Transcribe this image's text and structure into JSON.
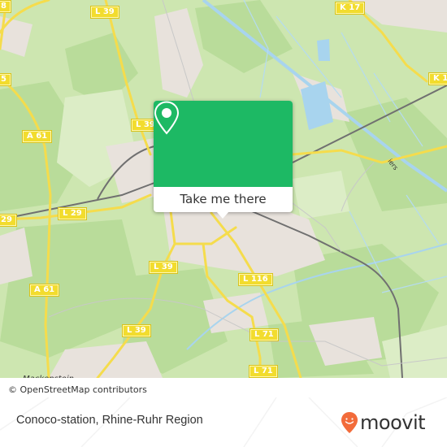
{
  "map": {
    "road_labels": [
      {
        "id": "l39-top",
        "text": "L 39"
      },
      {
        "id": "k17",
        "text": "K 17"
      },
      {
        "id": "k1-right",
        "text": "K 1"
      },
      {
        "id": "edge-8",
        "text": "8"
      },
      {
        "id": "edge-5",
        "text": "5"
      },
      {
        "id": "a61-upper",
        "text": "A 61"
      },
      {
        "id": "l39-mid",
        "text": "L 39"
      },
      {
        "id": "l29-left",
        "text": "29"
      },
      {
        "id": "l29",
        "text": "L 29"
      },
      {
        "id": "l39-lower",
        "text": "L 39"
      },
      {
        "id": "a61-lower",
        "text": "A 61"
      },
      {
        "id": "l116",
        "text": "L 116"
      },
      {
        "id": "l39-bottom",
        "text": "L 39"
      },
      {
        "id": "l71",
        "text": "L 71"
      },
      {
        "id": "l71-bottom",
        "text": "L 71"
      }
    ],
    "place_labels": [
      {
        "id": "mackenstein",
        "text": "Mackenstein"
      }
    ],
    "street_labels": [
      {
        "id": "viersen",
        "text": "iers"
      }
    ],
    "attribution": "© OpenStreetMap contributors",
    "colors": {
      "land": "#cde6b0",
      "forest": "#b9dc9a",
      "urban": "#e8e2dc",
      "water": "#a8d4ee",
      "road": "#f5dc4c",
      "rail": "#707070"
    }
  },
  "popup": {
    "icon": "map-pin-icon",
    "button_label": "Take me there",
    "accent_color": "#1db964"
  },
  "footer": {
    "title": "Conoco-station, Rhine-Ruhr Region",
    "logo_text": "moovit",
    "logo_icon": "moovit-smile-pin-icon",
    "logo_color": "#f26b3a"
  }
}
